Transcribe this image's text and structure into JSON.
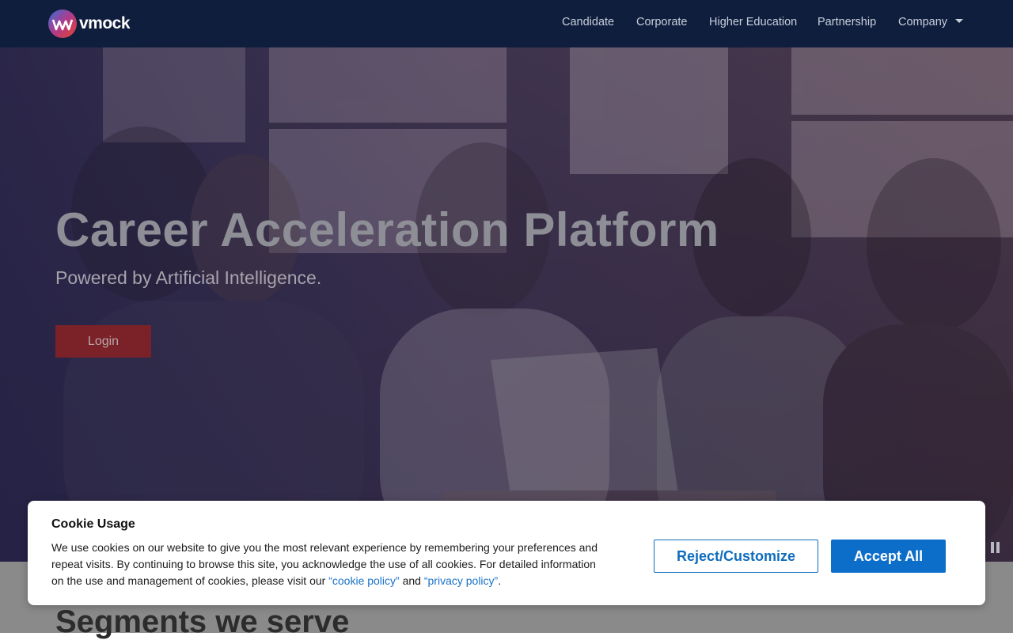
{
  "header": {
    "logo_text": "vmock",
    "nav": [
      {
        "label": "Candidate"
      },
      {
        "label": "Corporate"
      },
      {
        "label": "Higher Education"
      },
      {
        "label": "Partnership"
      },
      {
        "label": "Company"
      }
    ]
  },
  "hero": {
    "title": "Career Acceleration Platform",
    "subtitle": "Powered by Artificial Intelligence.",
    "login_label": "Login"
  },
  "segments": {
    "title": "Segments we serve"
  },
  "cookie": {
    "title": "Cookie Usage",
    "text_before": "We use cookies on our website to give you the most relevant experience by remembering your preferences and repeat visits. By continuing to browse this site, you acknowledge the use of all cookies. For detailed information on the use and management of cookies, please visit our ",
    "cookie_policy_link": "“cookie policy”",
    "text_and": " and ",
    "privacy_policy_link": "“privacy policy”",
    "text_end": ".",
    "reject_label": "Reject/Customize",
    "accept_label": "Accept All"
  },
  "icons": {
    "logo": "vmock-logo-icon",
    "dropdown": "chevron-down-icon",
    "pause": "pause-icon"
  },
  "colors": {
    "navbar_bg": "#0f1e3d",
    "login_bg": "#7a2228",
    "accept_bg": "#0d6ec9",
    "link": "#1a73c8"
  }
}
